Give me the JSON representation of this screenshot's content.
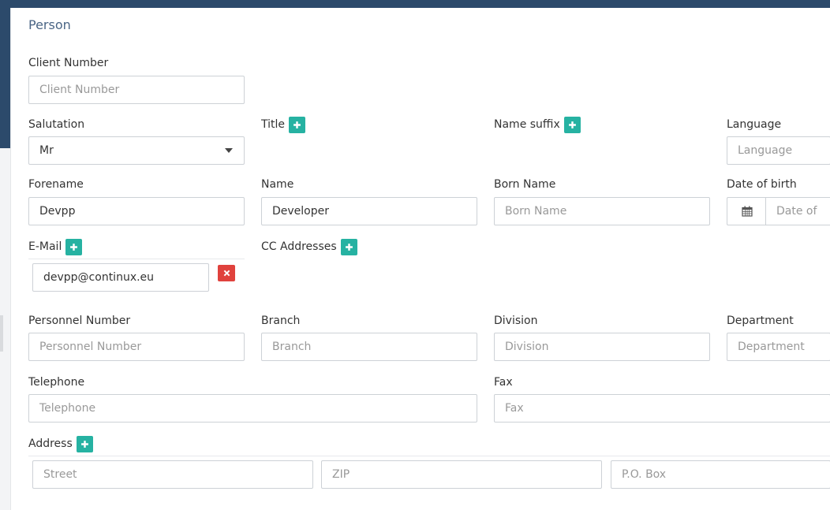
{
  "panel": {
    "title": "Person"
  },
  "fields": {
    "client_number": {
      "label": "Client Number",
      "placeholder": "Client Number",
      "value": ""
    },
    "salutation": {
      "label": "Salutation",
      "value": "Mr"
    },
    "title": {
      "label": "Title"
    },
    "name_suffix": {
      "label": "Name suffix"
    },
    "language": {
      "label": "Language",
      "placeholder": "Language",
      "value": ""
    },
    "forename": {
      "label": "Forename",
      "value": "Devpp"
    },
    "name": {
      "label": "Name",
      "value": "Developer"
    },
    "born_name": {
      "label": "Born Name",
      "placeholder": "Born Name",
      "value": ""
    },
    "date_of_birth": {
      "label": "Date of birth",
      "placeholder": "Date of birth",
      "value": ""
    },
    "email": {
      "label": "E-Mail",
      "value": "devpp@continux.eu"
    },
    "cc_addresses": {
      "label": "CC Addresses"
    },
    "personnel_number": {
      "label": "Personnel Number",
      "placeholder": "Personnel Number",
      "value": ""
    },
    "branch": {
      "label": "Branch",
      "placeholder": "Branch",
      "value": ""
    },
    "division": {
      "label": "Division",
      "placeholder": "Division",
      "value": ""
    },
    "department": {
      "label": "Department",
      "placeholder": "Department",
      "value": ""
    },
    "telephone": {
      "label": "Telephone",
      "placeholder": "Telephone",
      "value": ""
    },
    "fax": {
      "label": "Fax",
      "placeholder": "Fax",
      "value": ""
    },
    "address": {
      "label": "Address",
      "street_placeholder": "Street",
      "zip_placeholder": "ZIP",
      "po_box_placeholder": "P.O. Box"
    }
  },
  "icons": {
    "add": "plus-icon",
    "remove": "close-icon",
    "calendar": "calendar-icon",
    "dropdown": "caret-down-icon"
  },
  "colors": {
    "accent": "#26b2a2",
    "danger": "#e0423d",
    "header": "#2c4a6b"
  }
}
